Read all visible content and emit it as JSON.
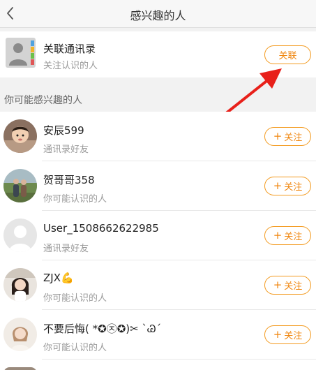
{
  "header": {
    "title": "感兴趣的人"
  },
  "contacts_card": {
    "title": "关联通讯录",
    "subtitle": "关注认识的人",
    "button_label": "关联"
  },
  "section_label": "你可能感兴趣的人",
  "follow_label": "关注",
  "people": [
    {
      "name": "安辰599",
      "subtitle": "通讯录好友",
      "avatar": "child-photo-avatar"
    },
    {
      "name": "贺哥哥358",
      "subtitle": "你可能认识的人",
      "avatar": "couple-photo-avatar"
    },
    {
      "name": "User_1508662622985",
      "subtitle": "通讯录好友",
      "avatar": "default-avatar"
    },
    {
      "name": "ZJX💪",
      "subtitle": "你可能认识的人",
      "avatar": "girl-photo-avatar"
    },
    {
      "name": "不要后悔( *✪㉨✪)✂ ˋᏊˊ",
      "subtitle": "你可能认识的人",
      "avatar": "woman-photo-avatar"
    }
  ],
  "colors": {
    "accent": "#f39a1e",
    "annotation_arrow": "#e8201a"
  }
}
